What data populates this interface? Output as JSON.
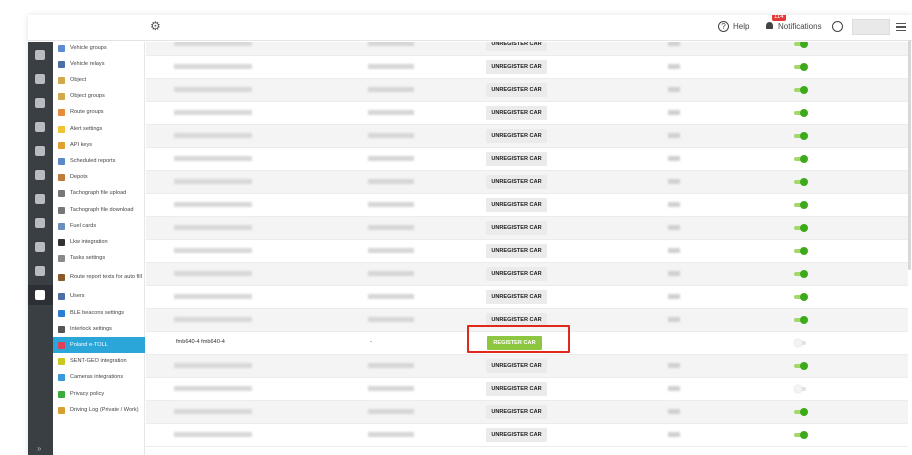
{
  "topbar": {
    "help_label": "Help",
    "notifications_label": "Notifications",
    "notification_count": "114"
  },
  "sidebar": {
    "items": [
      {
        "label": "Vehicle groups",
        "icon": "vehicle-groups-icon",
        "color": "#5b8bd0"
      },
      {
        "label": "Vehicle relays",
        "icon": "car-icon",
        "color": "#4a6fa5"
      },
      {
        "label": "Object",
        "icon": "object-icon",
        "color": "#d2a84b"
      },
      {
        "label": "Object groups",
        "icon": "object-groups-icon",
        "color": "#d2a84b"
      },
      {
        "label": "Route groups",
        "icon": "route-groups-icon",
        "color": "#e68a3c"
      },
      {
        "label": "Alert settings",
        "icon": "warning-icon",
        "color": "#f1c232"
      },
      {
        "label": "API keys",
        "icon": "key-icon",
        "color": "#e0a030"
      },
      {
        "label": "Scheduled reports",
        "icon": "clock-icon",
        "color": "#5a88c8"
      },
      {
        "label": "Depots",
        "icon": "depot-icon",
        "color": "#c07a3a"
      },
      {
        "label": "Tachograph file upload",
        "icon": "tachograph-icon",
        "color": "#777777"
      },
      {
        "label": "Tachograph file download",
        "icon": "tachograph-icon",
        "color": "#777777"
      },
      {
        "label": "Fuel cards",
        "icon": "card-icon",
        "color": "#6a8fbf"
      },
      {
        "label": "Lkw integration",
        "icon": "lkw-icon",
        "color": "#333333"
      },
      {
        "label": "Tasks settings",
        "icon": "tasks-icon",
        "color": "#8a8a8a"
      },
      {
        "label": "Route report texts for auto fill",
        "icon": "report-icon",
        "color": "#8b5a2b"
      },
      {
        "label": "Users",
        "icon": "users-icon",
        "color": "#4a6fa5"
      },
      {
        "label": "BLE beacons settings",
        "icon": "bluetooth-icon",
        "color": "#2a7fd4"
      },
      {
        "label": "Interlock settings",
        "icon": "interlock-icon",
        "color": "#555555"
      },
      {
        "label": "Poland e-TOLL",
        "icon": "etoll-icon",
        "color": "#e0405a"
      },
      {
        "label": "SENT-GEO integration",
        "icon": "sentgeo-icon",
        "color": "#c8c820"
      },
      {
        "label": "Cameras integrations",
        "icon": "camera-icon",
        "color": "#3a9ad9"
      },
      {
        "label": "Privacy policy",
        "icon": "privacy-icon",
        "color": "#3caa3c"
      },
      {
        "label": "Driving Log (Private / Work)",
        "icon": "driving-log-icon",
        "color": "#d8a030"
      }
    ]
  },
  "table": {
    "unregister_label": "UNREGISTER CAR",
    "register_label": "REGISTER CAR",
    "special_row": {
      "name": "fmb640-4 fmb640-4",
      "id": "-"
    }
  },
  "colors": {
    "accent": "#2aa6d9",
    "register_green": "#8dc63f",
    "toggle_on": "#3caa1a",
    "highlight": "#e0281e"
  }
}
